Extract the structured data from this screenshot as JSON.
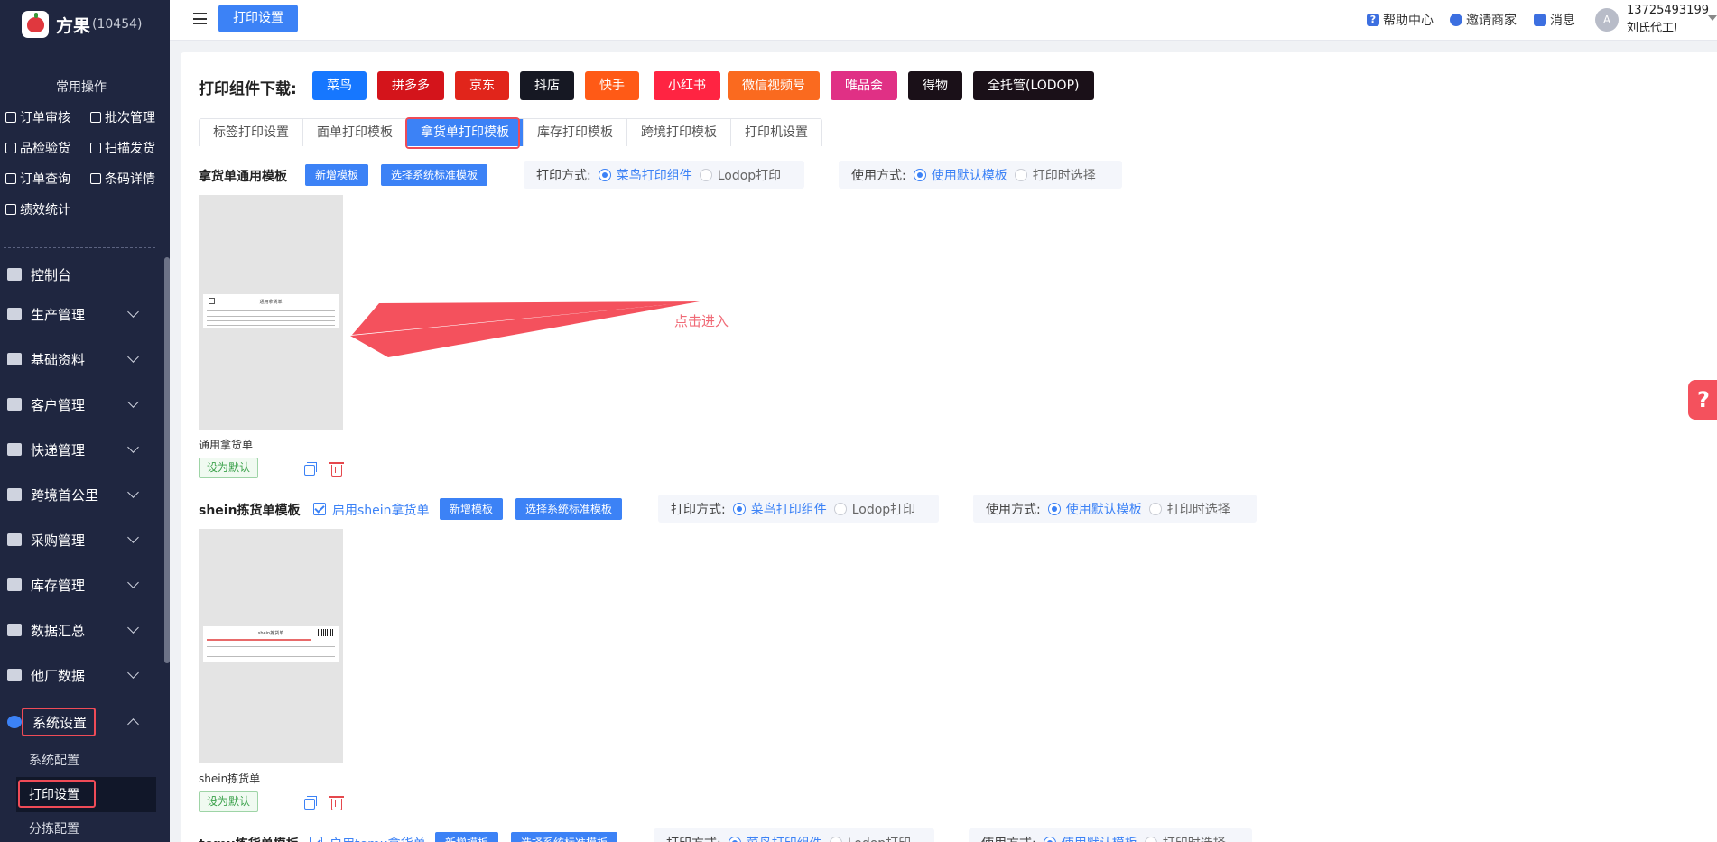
{
  "app": {
    "name": "方果",
    "code": "(10454)"
  },
  "sidebar": {
    "common_title": "常用操作",
    "quick_ops": [
      "订单审核",
      "批次管理",
      "品检验货",
      "扫描发货",
      "订单查询",
      "条码详情",
      "绩效统计"
    ],
    "menus": [
      "控制台",
      "生产管理",
      "基础资料",
      "客户管理",
      "快递管理",
      "跨境首公里",
      "采购管理",
      "库存管理",
      "数据汇总",
      "他厂数据",
      "系统设置"
    ],
    "submenus": [
      "系统配置",
      "打印设置",
      "分拣配置"
    ]
  },
  "topbar": {
    "tab": "打印设置",
    "help": "帮助中心",
    "invite": "邀请商家",
    "message": "消息",
    "user_phone": "13725493199",
    "user_name": "刘氏代工厂",
    "avatar": "A"
  },
  "download": {
    "label": "打印组件下载:",
    "buttons": [
      {
        "label": "菜鸟",
        "color": "#1677ff"
      },
      {
        "label": "拼多多",
        "color": "#d4141b"
      },
      {
        "label": "京东",
        "color": "#e1251b"
      },
      {
        "label": "抖店",
        "color": "#161823"
      },
      {
        "label": "快手",
        "color": "#ff5a16"
      },
      {
        "label": "小红书",
        "color": "#ff2442"
      },
      {
        "label": "微信视频号",
        "color": "#fa6a1f"
      },
      {
        "label": "唯品会",
        "color": "#e03085"
      },
      {
        "label": "得物",
        "color": "#1a1018"
      },
      {
        "label": "全托管(LODOP)",
        "color": "#1a1018"
      }
    ]
  },
  "tabs": [
    "标签打印设置",
    "面单打印模板",
    "拿货单打印模板",
    "库存打印模板",
    "跨境打印模板",
    "打印机设置"
  ],
  "section1": {
    "title": "拿货单通用模板",
    "new_btn": "新增模板",
    "choose_btn": "选择系统标准模板",
    "print_mode_label": "打印方式:",
    "print_opt1": "菜鸟打印组件",
    "print_opt2": "Lodop打印",
    "use_mode_label": "使用方式:",
    "use_opt1": "使用默认模板",
    "use_opt2": "打印时选择",
    "template_name": "通用拿货单",
    "preview_title": "通用拿货单",
    "default_btn": "设为默认"
  },
  "section2": {
    "title": "shein拣货单模板",
    "enable": "启用shein拿货单",
    "new_btn": "新增模板",
    "choose_btn": "选择系统标准模板",
    "print_mode_label": "打印方式:",
    "print_opt1": "菜鸟打印组件",
    "print_opt2": "Lodop打印",
    "use_mode_label": "使用方式:",
    "use_opt1": "使用默认模板",
    "use_opt2": "打印时选择",
    "template_name": "shein拣货单",
    "preview_title": "shein拣货单",
    "default_btn": "设为默认"
  },
  "section3": {
    "title": "temu拣货单模板",
    "enable": "启用temu拿货单",
    "new_btn": "新增模板",
    "choose_btn": "选择系统标准模板",
    "print_mode_label": "打印方式:",
    "print_opt1": "菜鸟打印组件",
    "print_opt2": "Lodop打印",
    "use_mode_label": "使用方式:",
    "use_opt1": "使用默认模板",
    "use_opt2": "打印时选择"
  },
  "annotation": "点击进入",
  "help_float": "?"
}
